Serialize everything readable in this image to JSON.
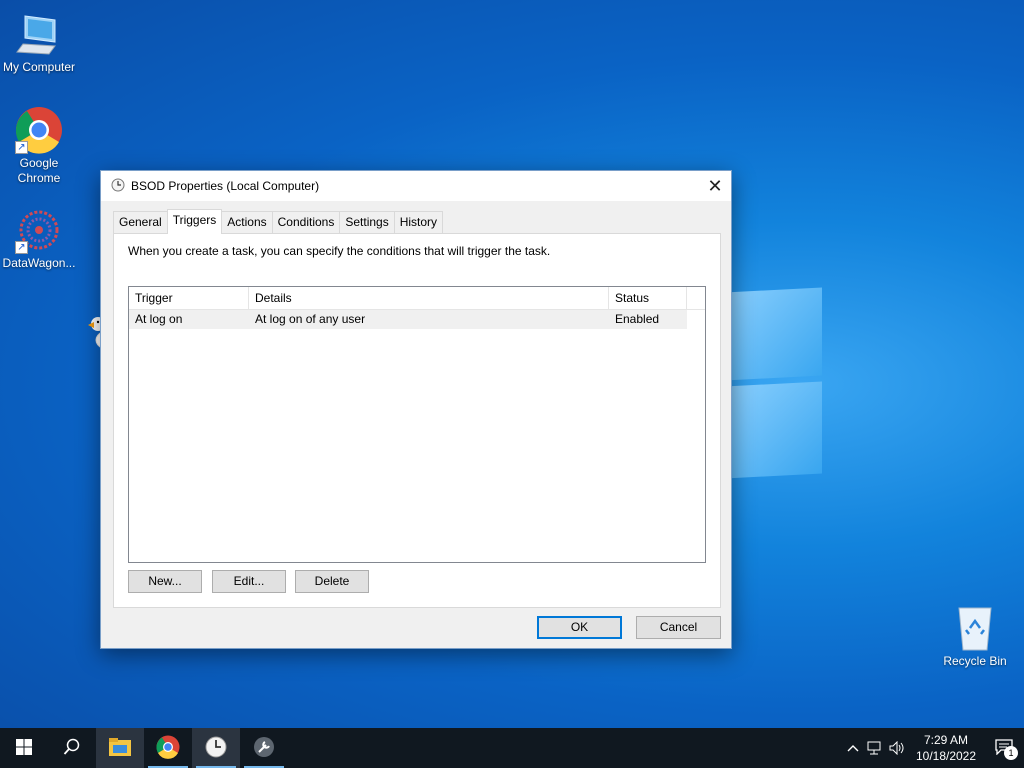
{
  "desktop": {
    "icons": [
      {
        "label": "My Computer"
      },
      {
        "label": "Google Chrome"
      },
      {
        "label": "DataWagon..."
      },
      {
        "label": "Recycle Bin"
      }
    ]
  },
  "window": {
    "title": "BSOD Properties (Local Computer)",
    "tabs": [
      "General",
      "Triggers",
      "Actions",
      "Conditions",
      "Settings",
      "History"
    ],
    "active_tab": "Triggers",
    "description": "When you create a task, you can specify the conditions that will trigger the task.",
    "list": {
      "columns": [
        "Trigger",
        "Details",
        "Status"
      ],
      "rows": [
        {
          "trigger": "At log on",
          "details": "At log on of any user",
          "status": "Enabled"
        }
      ]
    },
    "buttons": {
      "new": "New...",
      "edit": "Edit...",
      "delete": "Delete",
      "ok": "OK",
      "cancel": "Cancel"
    }
  },
  "taskbar": {
    "apps": [
      "start-icon",
      "search-icon",
      "file-explorer-icon",
      "chrome-icon",
      "task-scheduler-icon",
      "tools-icon"
    ],
    "clock_time": "7:29 AM",
    "clock_date": "10/18/2022",
    "notification_count": "1"
  },
  "colors": {
    "accent": "#0078d7",
    "taskbar": "#101820",
    "desktop": "#0a63c5"
  }
}
